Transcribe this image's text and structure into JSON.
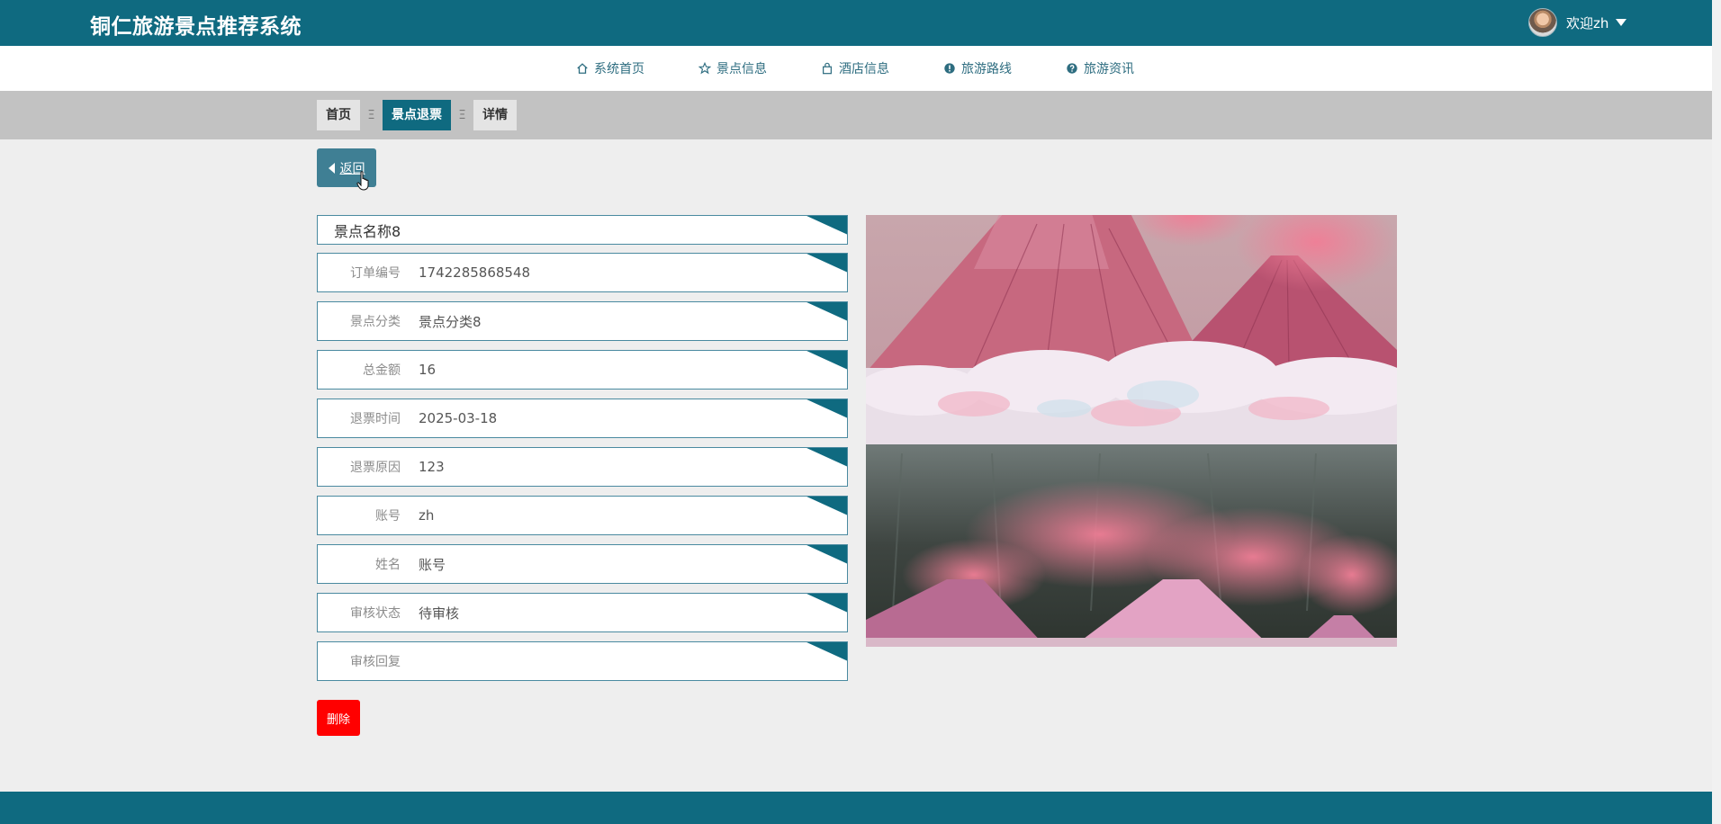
{
  "header": {
    "app_title": "铜仁旅游景点推荐系统",
    "user_greeting": "欢迎zh"
  },
  "nav": {
    "items": [
      {
        "label": "系统首页",
        "icon": "home-icon"
      },
      {
        "label": "景点信息",
        "icon": "star-icon"
      },
      {
        "label": "酒店信息",
        "icon": "shopping-bag-icon"
      },
      {
        "label": "旅游路线",
        "icon": "info-circle-icon"
      },
      {
        "label": "旅游资讯",
        "icon": "help-circle-icon"
      }
    ]
  },
  "breadcrumb": {
    "items": [
      "首页",
      "景点退票",
      "详情"
    ],
    "separator": "Ξ"
  },
  "actions": {
    "back_label": "返回",
    "delete_label": "删除"
  },
  "detail": {
    "title": "景点名称8",
    "fields": [
      {
        "label": "订单编号",
        "value": "1742285868548"
      },
      {
        "label": "景点分类",
        "value": "景点分类8"
      },
      {
        "label": "总金额",
        "value": "16"
      },
      {
        "label": "退票时间",
        "value": "2025-03-18"
      },
      {
        "label": "退票原因",
        "value": "123"
      },
      {
        "label": "账号",
        "value": "zh"
      },
      {
        "label": "姓名",
        "value": "账号"
      },
      {
        "label": "审核状态",
        "value": "待审核"
      },
      {
        "label": "审核回复",
        "value": ""
      }
    ]
  },
  "colors": {
    "primary": "#0f6a80",
    "delete": "#ff0000",
    "background": "#eeeeee"
  }
}
